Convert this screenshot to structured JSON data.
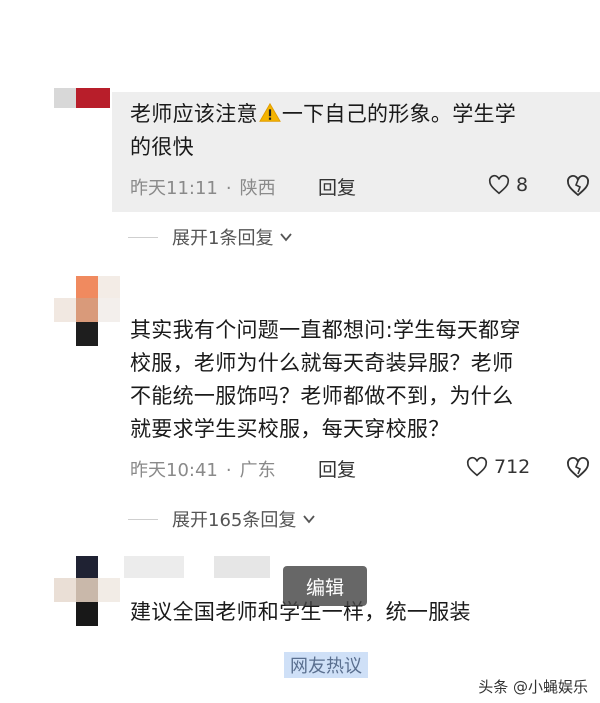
{
  "comments": [
    {
      "text_part1": "老师应该注意",
      "text_part2": "一下自己的形象。学生学",
      "text_line2": "的很快",
      "time": "昨天11:11",
      "location": "陕西",
      "reply_label": "回复",
      "likes": "8",
      "expand_label": "展开1条回复"
    },
    {
      "lines": [
        "其实我有个问题一直都想问:学生每天都穿",
        "校服，老师为什么就每天奇装异服？老师",
        "不能统一服饰吗？老师都做不到，为什么",
        "就要求学生买校服，每天穿校服？"
      ],
      "time": "昨天10:41",
      "location": "广东",
      "reply_label": "回复",
      "likes": "712",
      "expand_label": "展开165条回复"
    },
    {
      "text": "建议全国老师和学生一样，统一服装"
    }
  ],
  "separator": "·",
  "edit_popup": "编辑",
  "caption": "网友热议",
  "watermark": "头条 @小蝇娱乐",
  "colors": {
    "highlight_bg": "#eeeeee",
    "caption_bg": "#cfe0f7",
    "warning": "#f4b400"
  }
}
